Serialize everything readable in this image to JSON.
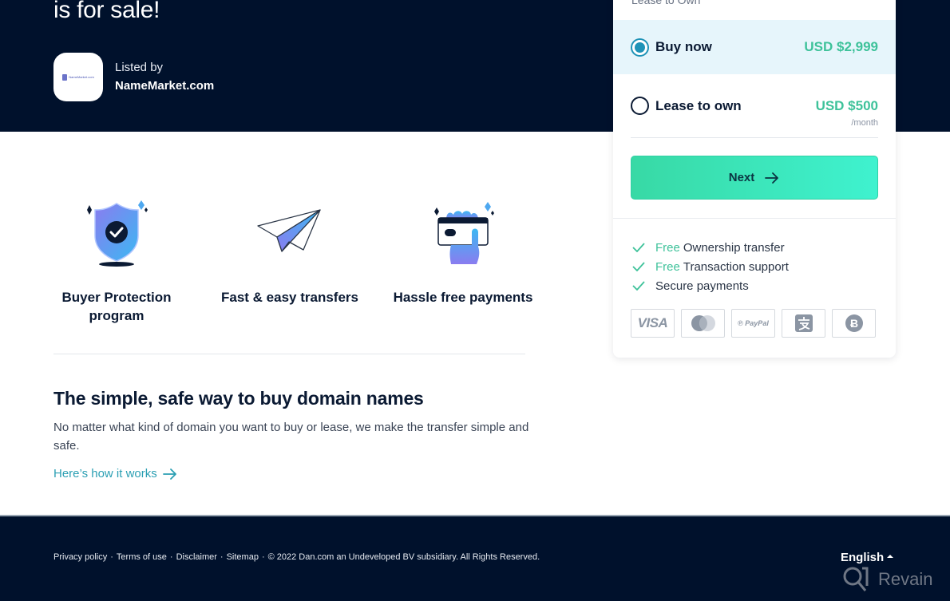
{
  "hero": {
    "title": "is for sale!",
    "listed_by_label": "Listed by",
    "seller_name": "NameMarket.com",
    "seller_logo_text": "NameMarket.com"
  },
  "purchase_card": {
    "top_label": "Lease to Own",
    "options": [
      {
        "label": "Buy now",
        "price": "USD $2,999",
        "period": "",
        "selected": true
      },
      {
        "label": "Lease to own",
        "price": "USD $500",
        "period": "/month",
        "selected": false
      }
    ],
    "next_label": "Next",
    "features": [
      {
        "highlight": "Free",
        "text": "Ownership transfer"
      },
      {
        "highlight": "Free",
        "text": "Transaction support"
      },
      {
        "highlight": "",
        "text": "Secure payments"
      }
    ],
    "payment_methods": [
      {
        "name": "visa",
        "label": "VISA"
      },
      {
        "name": "mastercard",
        "label": ""
      },
      {
        "name": "paypal",
        "label": "PayPal"
      },
      {
        "name": "alipay",
        "label": ""
      },
      {
        "name": "bitcoin",
        "label": ""
      }
    ]
  },
  "benefits": [
    {
      "icon": "shield-check-icon",
      "label": "Buyer Protection program"
    },
    {
      "icon": "paper-plane-icon",
      "label": "Fast & easy transfers"
    },
    {
      "icon": "card-hand-icon",
      "label": "Hassle free payments"
    }
  ],
  "info": {
    "title": "The simple, safe way to buy domain names",
    "description": "No matter what kind of domain you want to buy or lease, we make the transfer simple and safe.",
    "link_label": "Here’s how it works"
  },
  "footer": {
    "links": [
      "Privacy policy",
      "Terms of use",
      "Disclaimer",
      "Sitemap"
    ],
    "separator": "·",
    "copyright": "© 2022 Dan.com an Undeveloped BV subsidiary. All Rights Reserved.",
    "language": "English"
  },
  "watermark": {
    "text": "Revain"
  },
  "colors": {
    "navy": "#00112c",
    "accent_green": "#3ec29a",
    "button_gradient_start": "#38d9a5",
    "button_gradient_end": "#3ff2cf",
    "radio_selected": "#1f93b7",
    "link_teal": "#2b9fb3",
    "selected_row_bg": "#e6f5fb"
  }
}
